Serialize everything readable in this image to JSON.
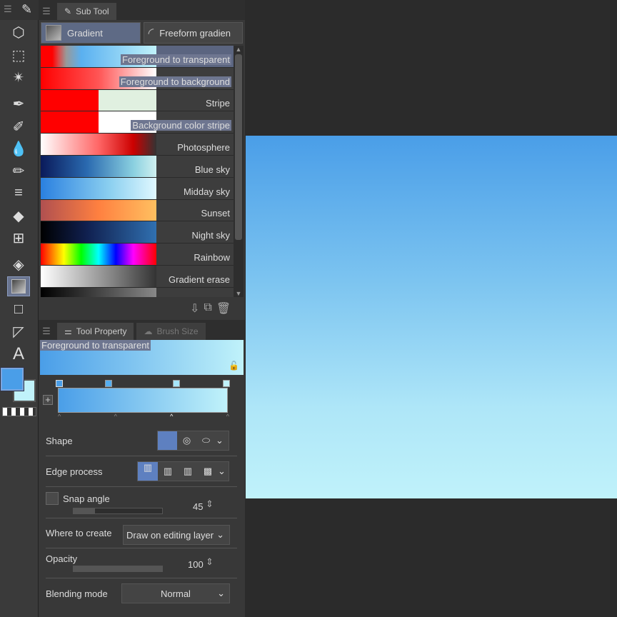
{
  "subtool": {
    "tab": "Sub Tool",
    "tabs": [
      "Gradient",
      "Freeform gradien"
    ],
    "presets": [
      {
        "label": "Foreground to transparent",
        "selected": true
      },
      {
        "label": "Foreground to background"
      },
      {
        "label": "Stripe"
      },
      {
        "label": "Background color stripe"
      },
      {
        "label": "Photosphere"
      },
      {
        "label": "Blue sky"
      },
      {
        "label": "Midday sky"
      },
      {
        "label": "Sunset"
      },
      {
        "label": "Night sky"
      },
      {
        "label": "Rainbow"
      },
      {
        "label": "Gradient erase"
      },
      {
        "label": ""
      }
    ]
  },
  "toolprop": {
    "tab": "Tool Property",
    "tab2": "Brush Size",
    "preview_label": "Foreground to transparent",
    "shape_label": "Shape",
    "edge_label": "Edge process",
    "snap_label": "Snap angle",
    "snap_value": "45",
    "where_label": "Where to create",
    "where_value": "Draw on editing layer",
    "opacity_label": "Opacity",
    "opacity_value": "100",
    "blend_label": "Blending mode",
    "blend_value": "Normal"
  },
  "colors": {
    "main": "#4a9ee8",
    "sub": "#c0f2fa"
  }
}
